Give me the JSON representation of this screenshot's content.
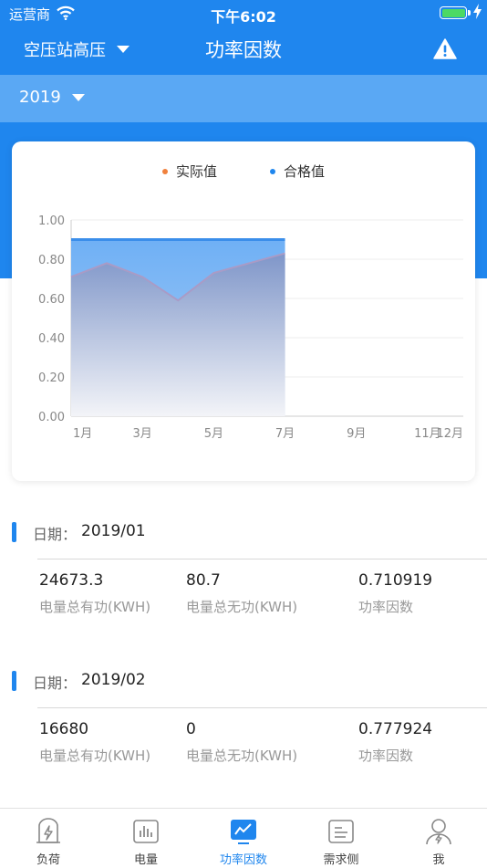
{
  "status": {
    "carrier": "运营商",
    "time": "下午6:02"
  },
  "nav": {
    "station": "空压站高压",
    "title": "功率因数",
    "alert_icon": "warning-icon"
  },
  "filter": {
    "year": "2019"
  },
  "colors": {
    "primary": "#1f86ee",
    "actual": "#f0813d",
    "qualified": "#1f86ee"
  },
  "chart_data": {
    "type": "area",
    "legend": [
      "实际值",
      "合格值"
    ],
    "x_labels": [
      "1月",
      "3月",
      "5月",
      "7月",
      "9月",
      "11月",
      "12月"
    ],
    "x": [
      1,
      2,
      3,
      4,
      5,
      6,
      7
    ],
    "y_ticks": [
      "1.00",
      "0.80",
      "0.60",
      "0.40",
      "0.20",
      "0.00"
    ],
    "ylim": [
      0,
      1
    ],
    "xlim": [
      1,
      12
    ],
    "series": [
      {
        "name": "实际值",
        "values": [
          0.71,
          0.78,
          0.71,
          0.59,
          0.73,
          0.78,
          0.83
        ]
      },
      {
        "name": "合格值",
        "values": [
          0.9,
          0.9,
          0.9,
          0.9,
          0.9,
          0.9,
          0.9
        ]
      }
    ],
    "grid": true,
    "legend_position": "top-center"
  },
  "records": [
    {
      "date_label": "日期：",
      "date": "2019/01",
      "active_power": "24673.3",
      "active_label": "电量总有功(KWH)",
      "reactive_power": "80.7",
      "reactive_label": "电量总无功(KWH)",
      "power_factor": "0.710919",
      "pf_label": "功率因数"
    },
    {
      "date_label": "日期：",
      "date": "2019/02",
      "active_power": "16680",
      "active_label": "电量总有功(KWH)",
      "reactive_power": "0",
      "reactive_label": "电量总无功(KWH)",
      "power_factor": "0.777924",
      "pf_label": "功率因数"
    }
  ],
  "tabs": [
    {
      "label": "负荷",
      "icon": "load-icon"
    },
    {
      "label": "电量",
      "icon": "electricity-icon"
    },
    {
      "label": "功率因数",
      "icon": "power-factor-icon",
      "active": true
    },
    {
      "label": "需求侧",
      "icon": "demand-side-icon"
    },
    {
      "label": "我",
      "icon": "profile-icon"
    }
  ]
}
